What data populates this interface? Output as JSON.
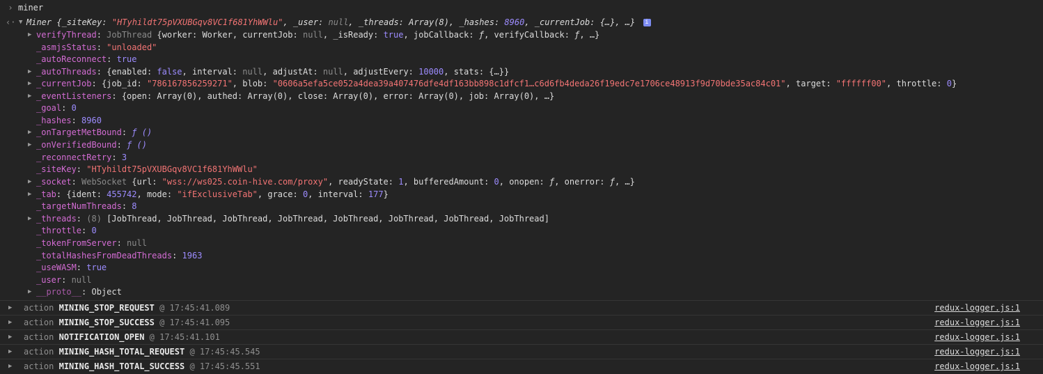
{
  "console": {
    "input_prompt": "›",
    "input_text": "miner",
    "result_prompt": "‹·",
    "summary": {
      "class_name": "Miner",
      "open": "{_siteKey: ",
      "sitekey": "\"HTyhildt75pVXUBGqv8VC1f681YhWWlu\"",
      "mid1": ", _user: ",
      "user": "null",
      "mid2": ", _threads: ",
      "threads": "Array(8)",
      "mid3": ", _hashes: ",
      "hashes": "8960",
      "mid4": ", _currentJob: ",
      "currentjob": "{…}",
      "tail": ", …}",
      "info": "i"
    },
    "props": {
      "verifyThread": {
        "key": "verifyThread",
        "type": "JobThread",
        "p1": "{worker: ",
        "worker": "Worker",
        "p2": ", currentJob: ",
        "currentjob": "null",
        "p3": ", _isReady: ",
        "isready": "true",
        "p4": ", jobCallback: ",
        "jobcallback": "ƒ",
        "p5": ", verifyCallback: ",
        "verifycallback": "ƒ",
        "tail": ", …}"
      },
      "asmjsStatus": {
        "key": "_asmjsStatus",
        "value": "\"unloaded\""
      },
      "autoReconnect": {
        "key": "_autoReconnect",
        "value": "true"
      },
      "autoThreads": {
        "key": "_autoThreads",
        "p1": "{enabled: ",
        "enabled": "false",
        "p2": ", interval: ",
        "interval": "null",
        "p3": ", adjustAt: ",
        "adjustat": "null",
        "p4": ", adjustEvery: ",
        "adjustevery": "10000",
        "p5": ", stats: ",
        "stats": "{…}",
        "tail": "}"
      },
      "currentJob": {
        "key": "_currentJob",
        "p1": "{job_id: ",
        "jobid": "\"786167856259271\"",
        "p2": ", blob: ",
        "blob": "\"0606a5efa5ce052a4dea39a407476dfe4df163bb898c1dfcf1…c6d6fb4deda26f19edc7e1706ce48913f9d70bde35ac84c01\"",
        "p3": ", target: ",
        "target": "\"ffffff00\"",
        "p4": ", throttle: ",
        "throttle": "0",
        "tail": "}"
      },
      "eventListeners": {
        "key": "_eventListeners",
        "p1": "{open: ",
        "open": "Array(0)",
        "p2": ", authed: ",
        "authed": "Array(0)",
        "p3": ", close: ",
        "close": "Array(0)",
        "p4": ", error: ",
        "error": "Array(0)",
        "p5": ", job: ",
        "job": "Array(0)",
        "tail": ", …}"
      },
      "goal": {
        "key": "_goal",
        "value": "0"
      },
      "hashes": {
        "key": "_hashes",
        "value": "8960"
      },
      "onTargetMetBound": {
        "key": "_onTargetMetBound",
        "value": "ƒ ()"
      },
      "onVerifiedBound": {
        "key": "_onVerifiedBound",
        "value": "ƒ ()"
      },
      "reconnectRetry": {
        "key": "_reconnectRetry",
        "value": "3"
      },
      "siteKey": {
        "key": "_siteKey",
        "value": "\"HTyhildt75pVXUBGqv8VC1f681YhWWlu\""
      },
      "socket": {
        "key": "_socket",
        "type": "WebSocket",
        "p1": "{url: ",
        "url": "\"wss://ws025.coin-hive.com/proxy\"",
        "p2": ", readyState: ",
        "readystate": "1",
        "p3": ", bufferedAmount: ",
        "bufferedamount": "0",
        "p4": ", onopen: ",
        "onopen": "ƒ",
        "p5": ", onerror: ",
        "onerror": "ƒ",
        "tail": ", …}"
      },
      "tab": {
        "key": "_tab",
        "p1": "{ident: ",
        "ident": "455742",
        "p2": ", mode: ",
        "mode": "\"ifExclusiveTab\"",
        "p3": ", grace: ",
        "grace": "0",
        "p4": ", interval: ",
        "interval": "177",
        "tail": "}"
      },
      "targetNumThreads": {
        "key": "_targetNumThreads",
        "value": "8"
      },
      "threads": {
        "key": "_threads",
        "count": "(8)",
        "value": "[JobThread, JobThread, JobThread, JobThread, JobThread, JobThread, JobThread, JobThread]"
      },
      "throttle": {
        "key": "_throttle",
        "value": "0"
      },
      "tokenFromServer": {
        "key": "_tokenFromServer",
        "value": "null"
      },
      "totalHashesFromDeadThreads": {
        "key": "_totalHashesFromDeadThreads",
        "value": "1963"
      },
      "useWASM": {
        "key": "_useWASM",
        "value": "true"
      },
      "user": {
        "key": "_user",
        "value": "null"
      },
      "proto": {
        "key": "__proto__",
        "value": "Object"
      }
    },
    "logs": [
      {
        "word": "action",
        "type": "MINING_STOP_REQUEST",
        "time": "@ 17:45:41.089",
        "source": "redux-logger.js:1"
      },
      {
        "word": "action",
        "type": "MINING_STOP_SUCCESS",
        "time": "@ 17:45:41.095",
        "source": "redux-logger.js:1"
      },
      {
        "word": "action",
        "type": "NOTIFICATION_OPEN",
        "time": "@ 17:45:41.101",
        "source": "redux-logger.js:1"
      },
      {
        "word": "action",
        "type": "MINING_HASH_TOTAL_REQUEST",
        "time": "@ 17:45:45.545",
        "source": "redux-logger.js:1"
      },
      {
        "word": "action",
        "type": "MINING_HASH_TOTAL_SUCCESS",
        "time": "@ 17:45:45.551",
        "source": "redux-logger.js:1"
      }
    ]
  },
  "colors": {
    "background": "#242424",
    "key": "#d36cd3",
    "string": "#f27474",
    "number": "#9d8cff",
    "null": "#8a8a8a"
  }
}
